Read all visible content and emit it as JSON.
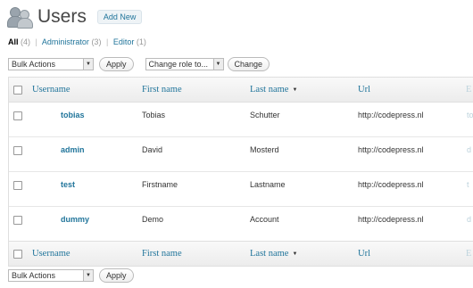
{
  "header": {
    "title": "Users",
    "add_new": "Add New"
  },
  "filters": [
    {
      "label": "All",
      "count": "(4)",
      "current": true
    },
    {
      "label": "Administrator",
      "count": "(3)",
      "current": false
    },
    {
      "label": "Editor",
      "count": "(1)",
      "current": false
    }
  ],
  "top_nav": {
    "bulk_actions": "Bulk Actions",
    "apply": "Apply",
    "change_role": "Change role to...",
    "change": "Change"
  },
  "bottom_nav": {
    "bulk_actions": "Bulk Actions",
    "apply": "Apply"
  },
  "columns": {
    "username": "Username",
    "first_name": "First name",
    "last_name": "Last name",
    "url": "Url",
    "truncated": "E"
  },
  "rows": [
    {
      "username": "tobias",
      "first_name": "Tobias",
      "last_name": "Schutter",
      "url": "http://codepress.nl",
      "extra": "to"
    },
    {
      "username": "admin",
      "first_name": "David",
      "last_name": "Mosterd",
      "url": "http://codepress.nl",
      "extra": "d"
    },
    {
      "username": "test",
      "first_name": "Firstname",
      "last_name": "Lastname",
      "url": "http://codepress.nl",
      "extra": "t"
    },
    {
      "username": "dummy",
      "first_name": "Demo",
      "last_name": "Account",
      "url": "http://codepress.nl",
      "extra": "d"
    }
  ]
}
